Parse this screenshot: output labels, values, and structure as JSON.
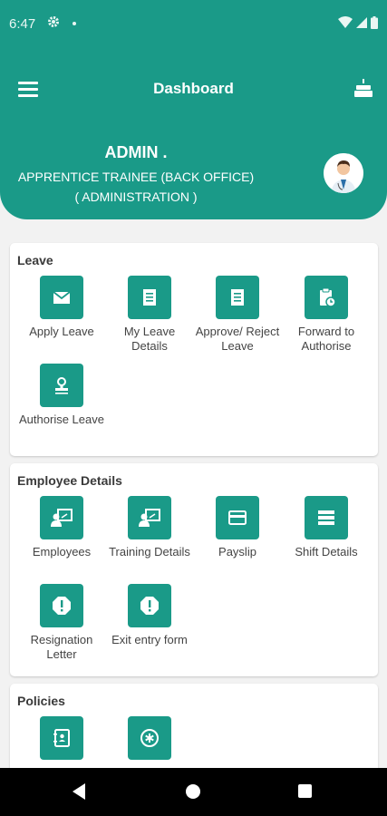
{
  "status_bar": {
    "time": "6:47"
  },
  "app_bar": {
    "title": "Dashboard"
  },
  "profile": {
    "name": "ADMIN .",
    "designation": "APPRENTICE TRAINEE (BACK OFFICE)",
    "department": "( ADMINISTRATION )"
  },
  "sections": [
    {
      "title": "Leave",
      "items": [
        {
          "label": "Apply Leave",
          "icon": "mail-icon"
        },
        {
          "label": "My Leave Details",
          "icon": "receipt-icon"
        },
        {
          "label": "Approve/ Reject Leave",
          "icon": "receipt-icon"
        },
        {
          "label": "Forward to Authorise",
          "icon": "clipboard-clock-icon"
        },
        {
          "label": "Authorise Leave",
          "icon": "stamp-icon"
        }
      ]
    },
    {
      "title": "Employee Details",
      "items": [
        {
          "label": "Employees",
          "icon": "presenter-icon"
        },
        {
          "label": "Training Details",
          "icon": "presenter-icon"
        },
        {
          "label": "Payslip",
          "icon": "card-icon"
        },
        {
          "label": "Shift Details",
          "icon": "list-icon"
        },
        {
          "label": "Resignation Letter",
          "icon": "alert-icon"
        },
        {
          "label": "Exit entry form",
          "icon": "alert-icon"
        }
      ]
    },
    {
      "title": "Policies",
      "items": [
        {
          "label": "",
          "icon": "contacts-book-icon"
        },
        {
          "label": "",
          "icon": "asterisk-badge-icon"
        }
      ]
    }
  ],
  "colors": {
    "primary": "#1a9a88",
    "background": "#f2f2f2"
  }
}
